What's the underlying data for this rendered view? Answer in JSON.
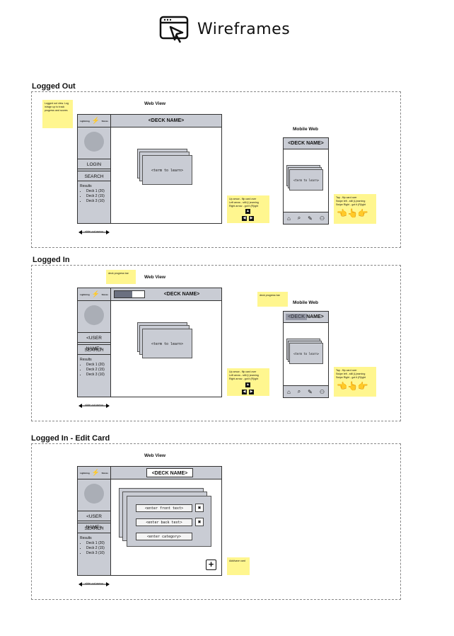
{
  "header": {
    "title": "Wireframes",
    "icon": "browser-cursor-icon"
  },
  "sections": [
    {
      "title": "Logged Out",
      "web_view_label": "Web View",
      "mobile_label": "Mobile Web",
      "sticky_login": "Logged out view. Log in/sign up to track progress and scores",
      "sidebar_brand_left": "Lightning",
      "sidebar_brand_right": "Stores",
      "sidebar_button_1": "LOGIN",
      "sidebar_button_2": "SEARCH",
      "results_label": "Results",
      "results": [
        "Deck 1 (20)",
        "Deck 2 (15)",
        "Deck 3 (10)"
      ],
      "deck_name": "<DECK NAME>",
      "card_text": "<term to learn>",
      "slide_label": "slide out menu",
      "sticky_keys": "Up arrow - flip card over\nLeft arrow - still (L)earning\nRight arrow - got it (R)ight",
      "sticky_gestures": "Tap - flip card over\nSwipe left - still (L)earning\nSwipe Right - got it (R)ight"
    },
    {
      "title": "Logged In",
      "web_view_label": "Web View",
      "mobile_label": "Mobile Web",
      "sticky_progress": "deck progress bar",
      "sticky_progress_mobile": "deck progress bar",
      "sidebar_brand_left": "Lightning",
      "sidebar_brand_right": "Stores",
      "sidebar_button_1": "<USER NAME>",
      "sidebar_button_2": "SEARCH",
      "results_label": "Results",
      "results": [
        "Deck 1 (20)",
        "Deck 2 (15)",
        "Deck 3 (10)"
      ],
      "deck_name": "<DECK NAME>",
      "card_text": "<term to learn>",
      "slide_label": "slide out menu",
      "sticky_keys": "Up arrow - flip card over\nLeft arrow - still (L)earning\nRight arrow - got it (R)ight",
      "sticky_gestures": "Tap - flip card over\nSwipe left - still (L)earning\nSwipe Right - got it (R)ight"
    },
    {
      "title": "Logged In - Edit Card",
      "web_view_label": "Web View",
      "sidebar_brand_left": "Lightning",
      "sidebar_brand_right": "Stores",
      "sidebar_button_1": "<USER NAME>",
      "sidebar_button_2": "SEARCH",
      "results_label": "Results",
      "results": [
        "Deck 1 (20)",
        "Deck 2 (15)",
        "Deck 3 (10)"
      ],
      "deck_name": "<DECK NAME>",
      "field_front": "<enter front text>",
      "field_back": "<enter back text>",
      "field_category": "<enter category>",
      "slide_label": "slide out menu",
      "sticky_add": "Add/save card"
    }
  ],
  "icons": {
    "arrow_up": "▲",
    "arrow_left": "◀",
    "arrow_right": "▶",
    "home": "⌂",
    "search": "⌕",
    "edit": "✎",
    "user": "👤",
    "add": "+"
  }
}
